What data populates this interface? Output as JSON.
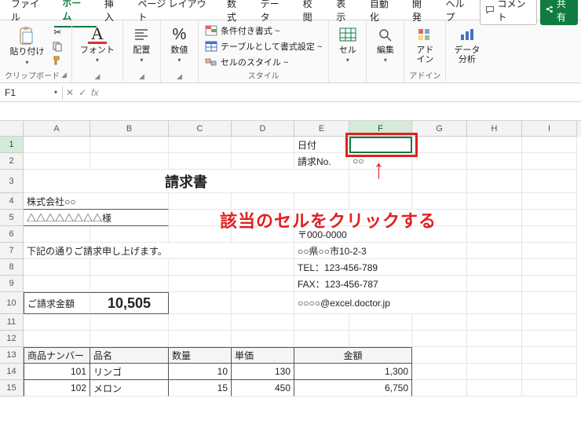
{
  "tabs": {
    "file": "ファイル",
    "home": "ホーム",
    "insert": "挿入",
    "pagelayout": "ページ レイアウト",
    "formulas": "数式",
    "data": "データ",
    "review": "校閲",
    "view": "表示",
    "automate": "自動化",
    "developer": "開発",
    "help": "ヘルプ"
  },
  "titlebar": {
    "comments": "コメント",
    "share": "共有"
  },
  "ribbon": {
    "clipboard": {
      "paste": "貼り付け",
      "label": "クリップボード"
    },
    "font": {
      "btn": "フォント"
    },
    "alignment": {
      "btn": "配置"
    },
    "number": {
      "btn": "数値"
    },
    "styles": {
      "cond": "条件付き書式 ~",
      "table": "テーブルとして書式設定 ~",
      "cell": "セルのスタイル ~",
      "label": "スタイル"
    },
    "cells": {
      "btn": "セル",
      "label": "セル"
    },
    "editing": {
      "btn": "編集",
      "label": "編集"
    },
    "addins": {
      "btn": "アド\nイン",
      "label": "アドイン"
    },
    "analysis": {
      "btn": "データ\n分析",
      "label": ""
    }
  },
  "fbar": {
    "name": "F1",
    "formula": ""
  },
  "cols": [
    "A",
    "B",
    "C",
    "D",
    "E",
    "F",
    "G",
    "H",
    "I"
  ],
  "rows": [
    "1",
    "2",
    "3",
    "4",
    "5",
    "6",
    "7",
    "8",
    "9",
    "10",
    "11",
    "12",
    "13",
    "14",
    "15"
  ],
  "doc": {
    "r1": {
      "E": "日付",
      "F": ""
    },
    "r2": {
      "E": "請求No.",
      "F": "○○"
    },
    "r3_title": "請求書",
    "r4_A": "株式会社○○",
    "r5_A": "△△△△△△△△様",
    "r6_E": "〒000-0000",
    "r7_A": "下記の通りご請求申し上げます。",
    "r7_E": "○○県○○市10-2-3",
    "r8_E": "TEL：123-456-789",
    "r9_E": "FAX：123-456-787",
    "r10_A": "ご請求金額",
    "r10_B": "10,505",
    "r10_E": "○○○○@excel.doctor.jp",
    "r13": {
      "A": "商品ナンバー",
      "B": "品名",
      "C": "数量",
      "D": "単価",
      "EF": "金額"
    },
    "r14": {
      "A": "101",
      "B": "リンゴ",
      "C": "10",
      "D": "130",
      "F": "1,300"
    },
    "r15": {
      "A": "102",
      "B": "メロン",
      "C": "15",
      "D": "450",
      "F": "6,750"
    }
  },
  "annotation": {
    "text": "該当のセルをクリックする"
  }
}
